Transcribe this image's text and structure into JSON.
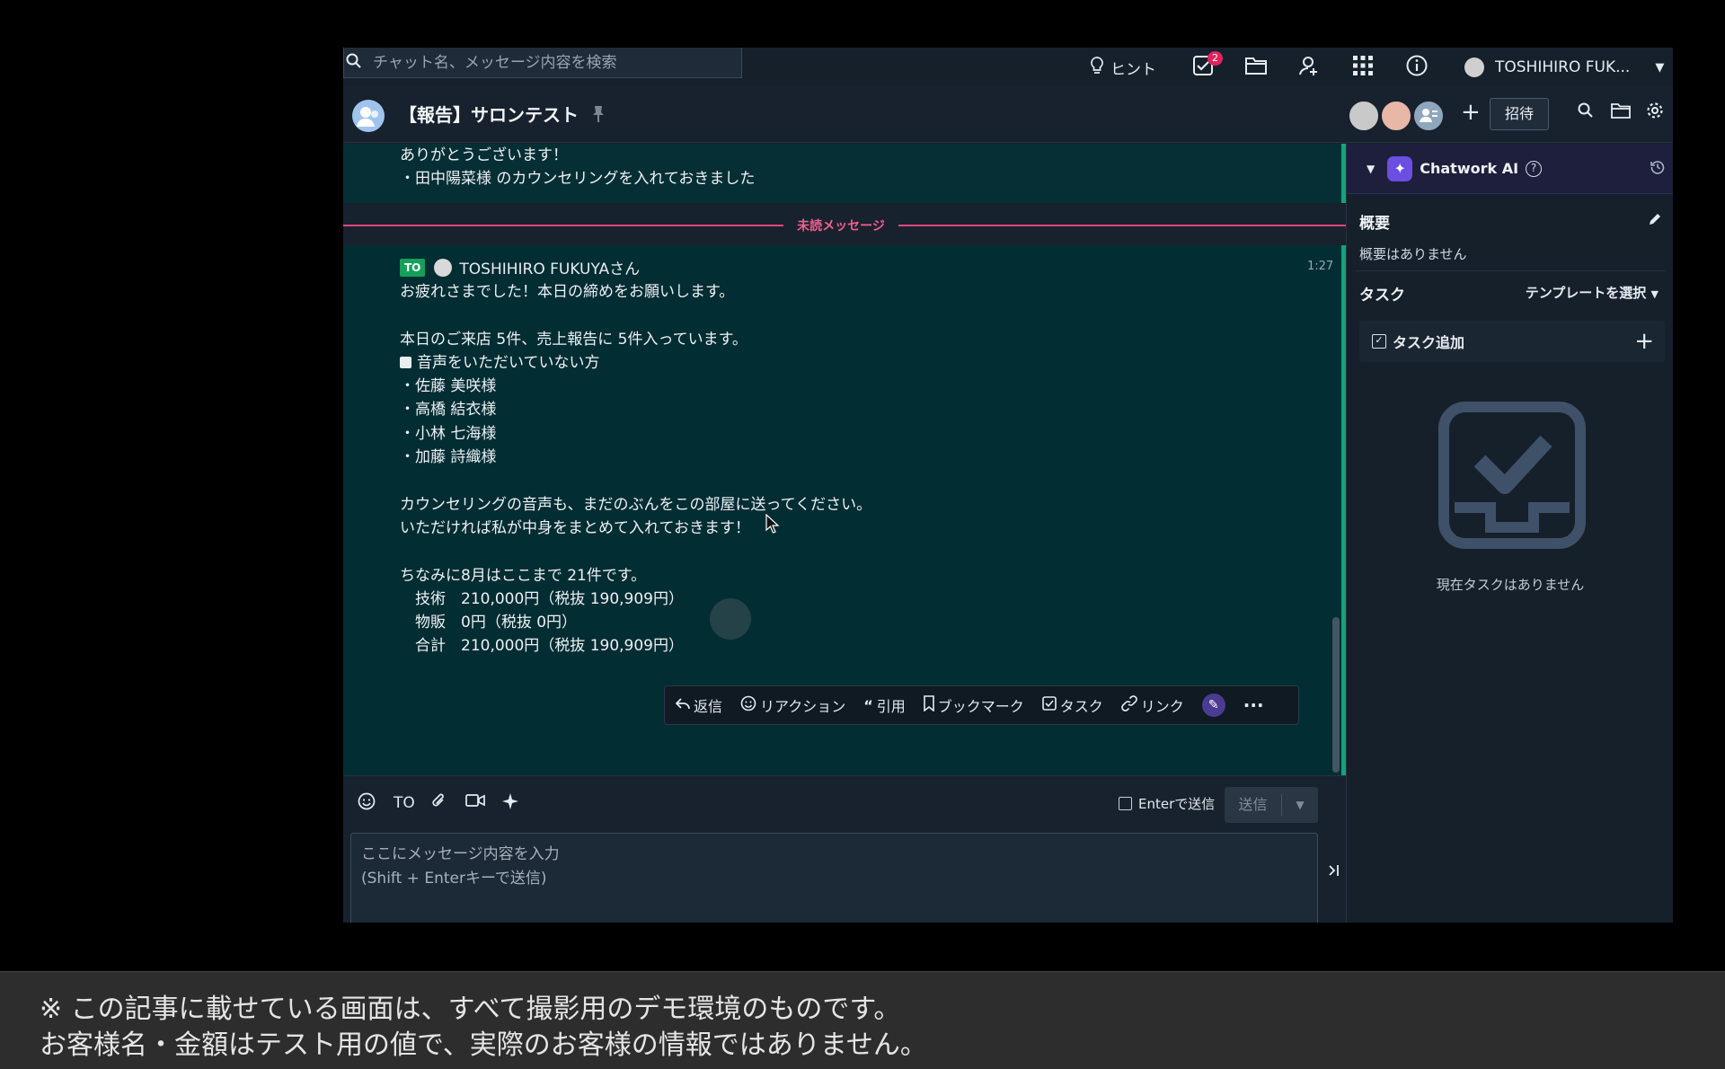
{
  "search": {
    "placeholder": "チャット名、メッセージ内容を検索"
  },
  "topbar": {
    "hint_label": "ヒント",
    "task_badge": "2",
    "user_name": "TOSHIHIRO FUK..."
  },
  "room": {
    "title": "【報告】サロンテスト",
    "invite_label": "招待"
  },
  "chat": {
    "previous_message": "ありがとうございます！\n・田中陽菜様 のカウンセリングを入れておきました",
    "unread_label": "未読メッセージ",
    "message": {
      "to_badge": "TO",
      "sender": "TOSHIHIRO FUKUYAさん",
      "time": "1:27",
      "body_1": "お疲れさまでした！本日の締めをお願いします。\n\n本日のご来店 5件、売上報告に 5件入っています。\n",
      "body_square_item": "音声をいただいていない方",
      "body_2": "・佐藤 美咲様\n・高橋 結衣様\n・小林 七海様\n・加藤 詩織様\n\nカウンセリングの音声も、まだのぶんをこの部屋に送ってください。\nいただければ私が中身をまとめて入れておきます！\n\nちなみに8月はここまで 21件です。\n　技術　210,000円（税抜 190,909円）\n　物販　0円（税抜 0円）\n　合計　210,000円（税抜 190,909円）"
    },
    "actions": {
      "reply": "返信",
      "reaction": "リアクション",
      "quote": "引用",
      "bookmark": "ブックマーク",
      "task": "タスク",
      "link": "リンク"
    }
  },
  "composer": {
    "to_label": "TO",
    "enter_send_label": "Enterで送信",
    "send_label": "送信",
    "placeholder": "ここにメッセージ内容を入力\n(Shift + Enterキーで送信)"
  },
  "right_panel": {
    "ai_title": "Chatwork AI",
    "summary_heading": "概要",
    "summary_empty": "概要はありません",
    "task_heading": "タスク",
    "template_label": "テンプレートを選択",
    "task_add_label": "タスク追加",
    "task_empty": "現在タスクはありません"
  },
  "caption": {
    "line1": "※ この記事に載せている画面は、すべて撮影用のデモ環境のものです。",
    "line2": "お客様名・金額はテスト用の値で、実際のお客様の情報ではありません。"
  },
  "colors": {
    "accent_green": "#16a37a",
    "unread_pink": "#e0487a",
    "ai_purple": "#6c4ee0",
    "message_bg": "#022d33"
  }
}
